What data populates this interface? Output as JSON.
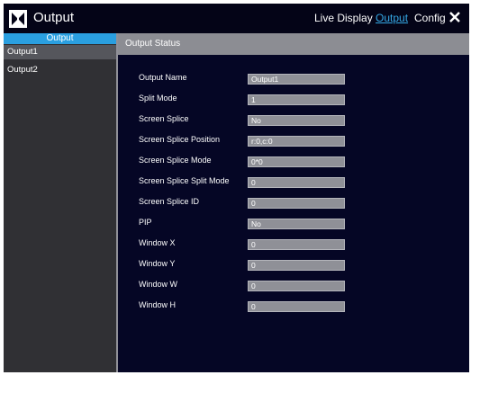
{
  "window": {
    "title": "Output"
  },
  "nav": {
    "live_display": "Live Display",
    "output": "Output",
    "config": "Config"
  },
  "colors": {
    "accent": "#35a9e6",
    "background": "#050625",
    "sidebar": "#303034",
    "header": "#8c8d93"
  },
  "icons": {
    "logo": "app-logo-icon",
    "close": "close-icon"
  },
  "sidebar": {
    "header": "Output",
    "items": [
      {
        "label": "Output1",
        "selected": true
      },
      {
        "label": "Output2",
        "selected": false
      }
    ]
  },
  "main": {
    "section_title": "Output Status",
    "fields": [
      {
        "label": "Output Name",
        "value": "Output1"
      },
      {
        "label": "Split Mode",
        "value": "1"
      },
      {
        "label": "Screen Splice",
        "value": "No"
      },
      {
        "label": "Screen Splice Position",
        "value": "r:0,c:0"
      },
      {
        "label": "Screen Splice Mode",
        "value": "0*0"
      },
      {
        "label": "Screen Splice Split Mode",
        "value": "0"
      },
      {
        "label": "Screen Splice ID",
        "value": "0"
      },
      {
        "label": "PIP",
        "value": "No"
      },
      {
        "label": "Window X",
        "value": "0"
      },
      {
        "label": "Window Y",
        "value": "0"
      },
      {
        "label": "Window W",
        "value": "0"
      },
      {
        "label": "Window H",
        "value": "0"
      }
    ]
  }
}
